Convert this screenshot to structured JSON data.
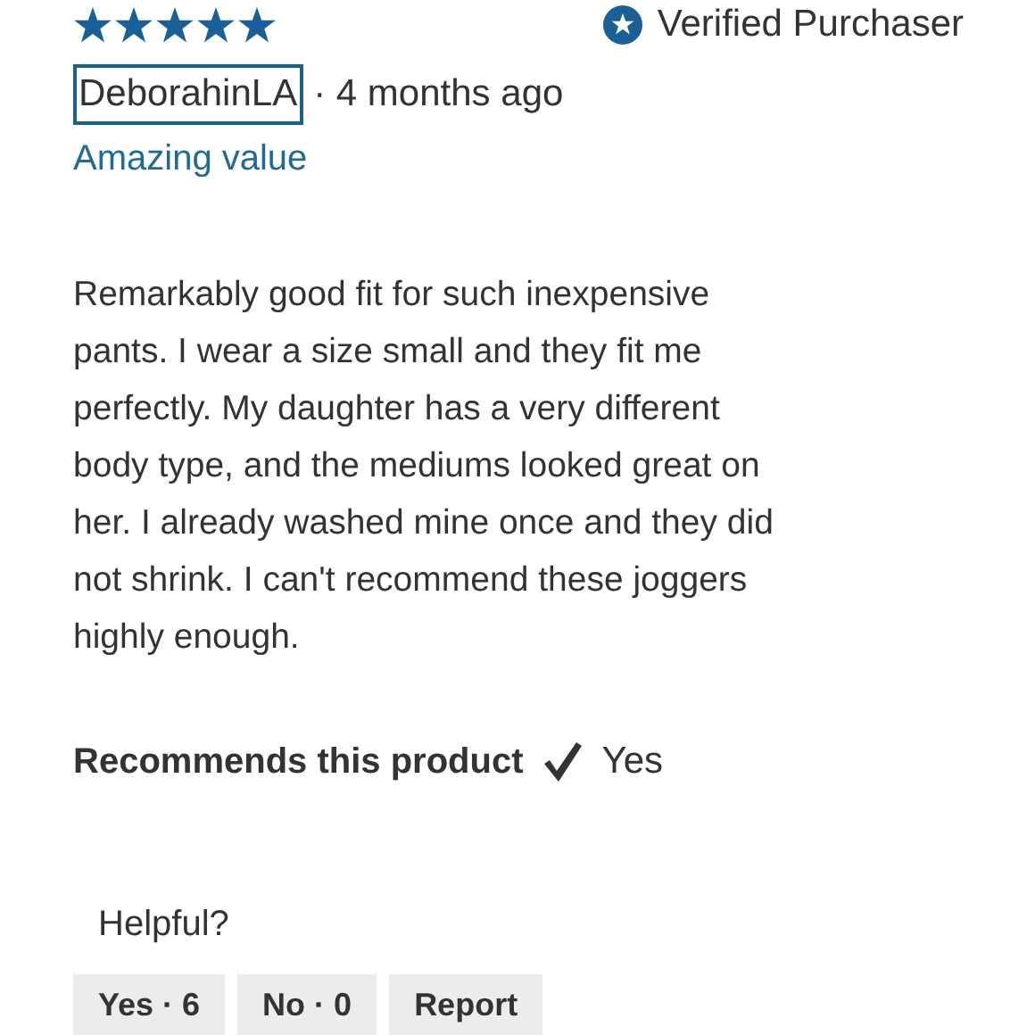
{
  "review": {
    "stars": 5,
    "verified": "Verified Purchaser",
    "author": "DeborahinLA",
    "author_focused": true,
    "time": "· 4 months ago",
    "title": "Amazing value",
    "body": "Remarkably good fit for such inexpensive\npants. I wear a size small and they fit me\nperfectly. My daughter has a very different\nbody type, and the mediums looked great on\nher. I already washed mine once and they did\nnot shrink. I can't recommend these joggers\nhighly enough.",
    "recommends_label": "Recommends this product",
    "recommends": true,
    "recommends_value": "Yes"
  },
  "helpful": {
    "label": "Helpful?",
    "buttons": [
      "Yes · 6",
      "No · 0",
      "Report"
    ]
  }
}
